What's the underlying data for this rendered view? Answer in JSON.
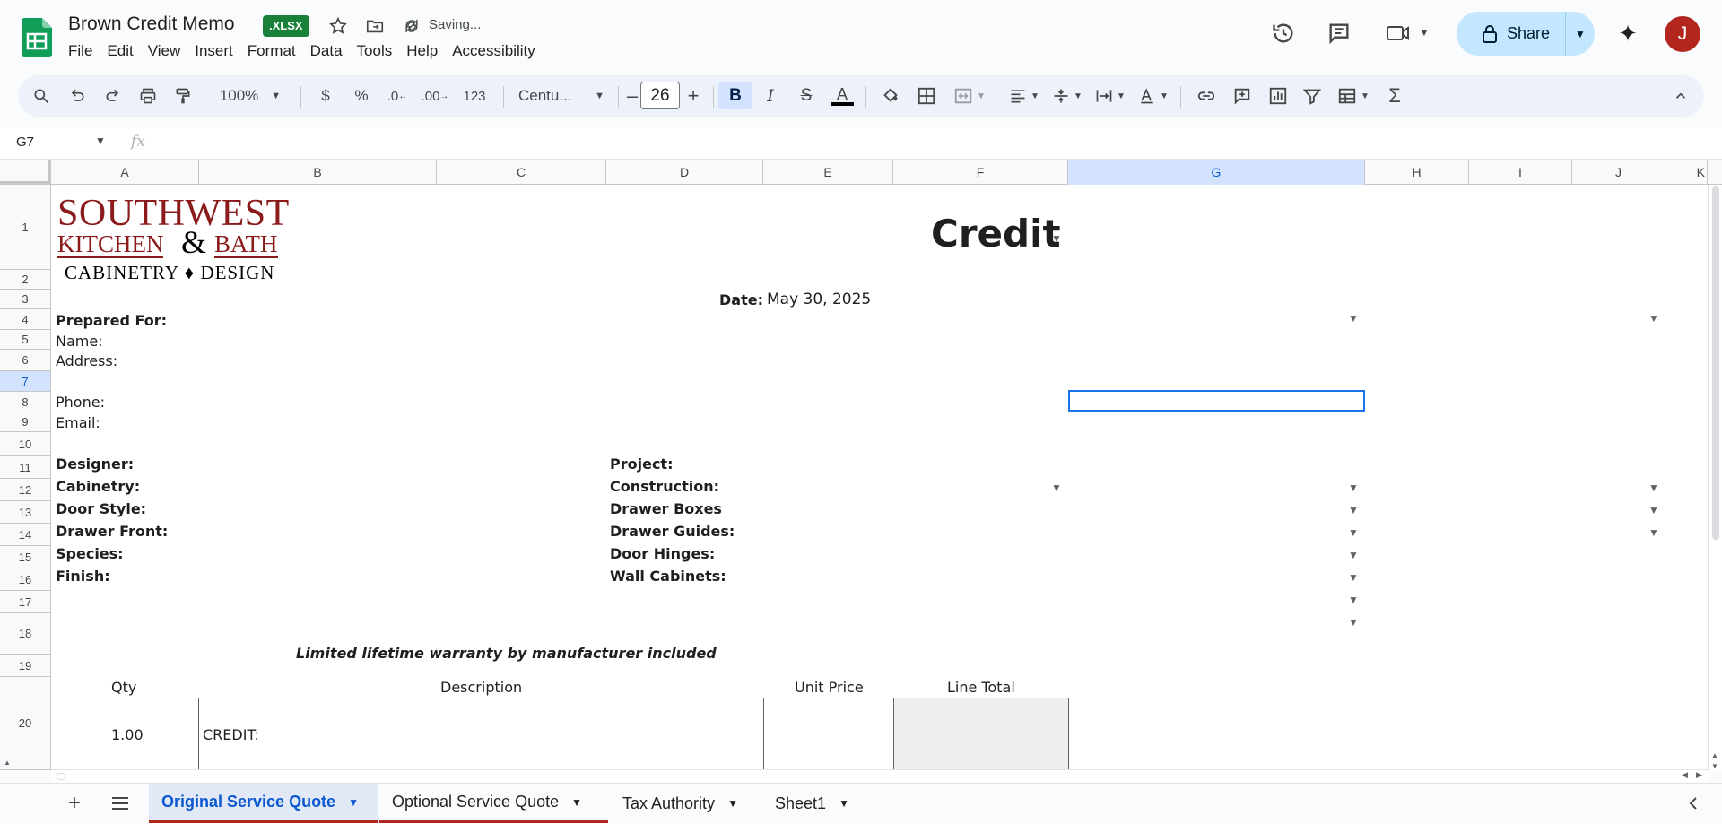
{
  "titlebar": {
    "doc_title": "Brown Credit Memo",
    "badge": ".XLSX",
    "status": "Saving...",
    "share_label": "Share",
    "avatar_letter": "J"
  },
  "menu": [
    "File",
    "Edit",
    "View",
    "Insert",
    "Format",
    "Data",
    "Tools",
    "Help",
    "Accessibility"
  ],
  "toolbar": {
    "zoom": "100%",
    "currency": "$",
    "percent": "%",
    "dec_decrease": ".0",
    "dec_increase": ".00",
    "number_format": "123",
    "font": "Centu...",
    "font_size": "26"
  },
  "formula_bar": {
    "cell_ref": "G7",
    "fx": "fx"
  },
  "columns": [
    "A",
    "B",
    "C",
    "D",
    "E",
    "F",
    "G",
    "H",
    "I",
    "J",
    "K"
  ],
  "rows": [
    "1",
    "2",
    "3",
    "4",
    "5",
    "6",
    "7",
    "8",
    "9",
    "10",
    "11",
    "12",
    "13",
    "14",
    "15",
    "16",
    "17",
    "18",
    "19",
    "20"
  ],
  "sheet": {
    "logo_line1": "SOUTHWEST",
    "logo_kitchen": "KITCHEN",
    "logo_amp": "&",
    "logo_bath": "BATH",
    "logo_line3": "CABINETRY ♦ DESIGN",
    "heading": "Credit",
    "date_label": "Date:",
    "date_value": "May 30, 2025",
    "prepared_for": "Prepared For:",
    "name": "Name:",
    "address": "Address:",
    "phone": "Phone:",
    "email": "Email:",
    "designer": "Designer:",
    "cabinetry": "Cabinetry:",
    "door_style": "Door Style:",
    "drawer_front": "Drawer Front:",
    "species": "Species:",
    "finish": "Finish:",
    "project": "Project:",
    "construction": "Construction:",
    "drawer_boxes": "Drawer Boxes",
    "drawer_guides": "Drawer Guides:",
    "door_hinges": "Door Hinges:",
    "wall_cabinets": "Wall Cabinets:",
    "warranty": "Limited lifetime warranty by manufacturer included",
    "hdr_qty": "Qty",
    "hdr_desc": "Description",
    "hdr_unit": "Unit Price",
    "hdr_total": "Line Total",
    "r20_qty": "1.00",
    "r20_desc": "CREDIT:"
  },
  "tabs": [
    "Original Service Quote",
    "Optional Service Quote",
    "Tax Authority",
    "Sheet1"
  ],
  "colors": {
    "accent": "#0b57d0",
    "brand_red": "#9b1c1c",
    "sheets_green": "#188038"
  }
}
